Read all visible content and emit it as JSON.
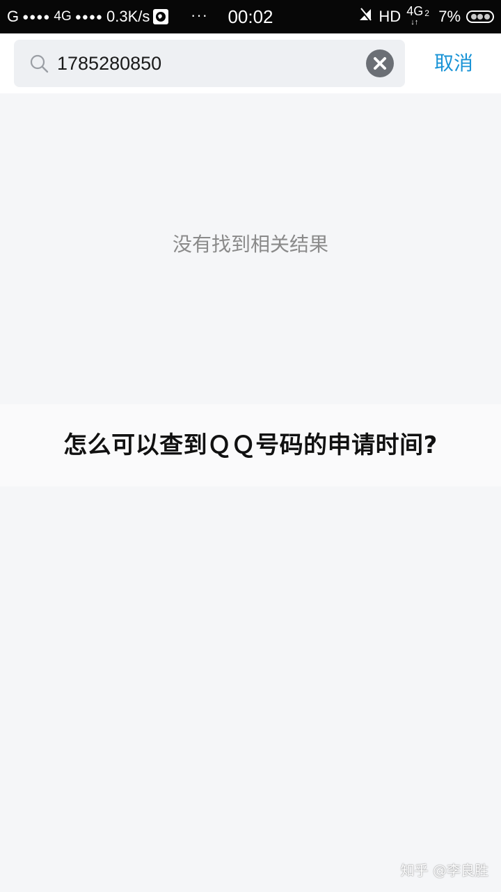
{
  "status_bar": {
    "carrier1": "G",
    "signal_dots": "●●●●",
    "network1": "4G",
    "network_speed": "0.3K/s",
    "more": "···",
    "time": "00:02",
    "hd": "HD",
    "network2": "4G",
    "network2_sub": "2",
    "battery_percent": "7%"
  },
  "search": {
    "query": "1785280850"
  },
  "header": {
    "cancel_label": "取消"
  },
  "results": {
    "empty_message": "没有找到相关结果"
  },
  "question": {
    "title": "怎么可以查到ＱＱ号码的申请时间?"
  },
  "watermark": {
    "text": "知乎 @李良胜"
  },
  "colors": {
    "accent": "#1993d6",
    "status_bar_bg": "#070707",
    "page_bg": "#f5f6f8"
  }
}
